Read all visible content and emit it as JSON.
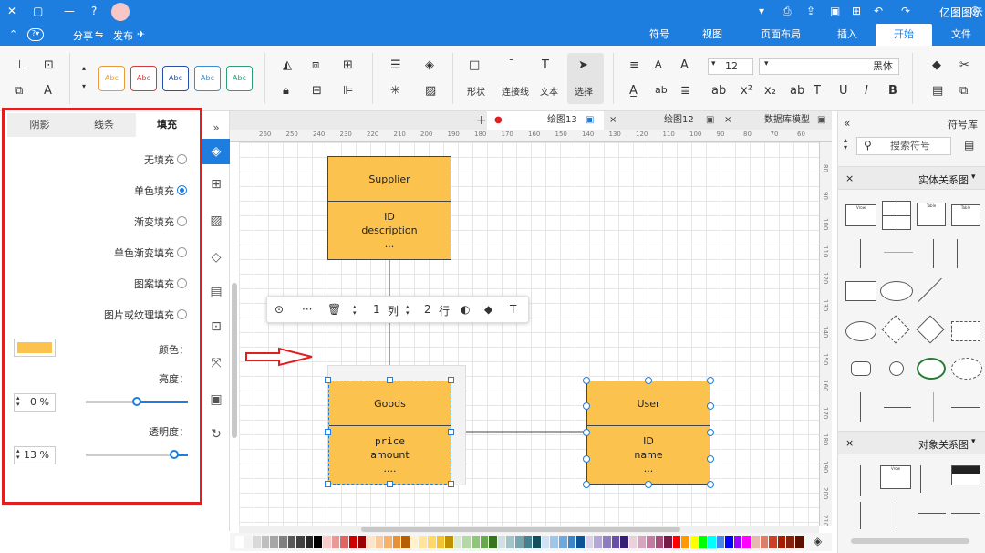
{
  "titlebar": {
    "app_name": "亿图图示",
    "file_label": "文件"
  },
  "menubar": {
    "tabs": [
      "开始",
      "插入",
      "页面布局",
      "视图",
      "符号"
    ],
    "active_tab": "开始",
    "file_label": "文件",
    "publish_label": "发布",
    "share_label": "分享"
  },
  "toolbar": {
    "font_name": "黑体",
    "font_size": "12",
    "select_label": "选择",
    "text_label": "文本",
    "connector_label": "连接线",
    "shape_label": "形状",
    "style_sample": "Abc"
  },
  "left_panel": {
    "tabs": [
      "填充",
      "线条",
      "阴影"
    ],
    "active_tab": "填充",
    "fill_options": [
      "无填充",
      "单色填充",
      "渐变填充",
      "单色渐变填充",
      "图案填充",
      "图片或纹理填充"
    ],
    "selected_option": "单色填充",
    "color_label": "颜色：",
    "brightness_label": "亮度：",
    "brightness_value": "0 %",
    "brightness_level": 0.5,
    "transparency_label": "透明度：",
    "transparency_value": "13 %",
    "transparency_level": 0.13,
    "fill_color": "#fcc24e"
  },
  "doc_tabs": [
    "数据库模型",
    "绘图12",
    "绘图13"
  ],
  "active_doc": "绘图13",
  "ruler_h": [
    "60",
    "70",
    "80",
    "90",
    "100",
    "110",
    "120",
    "130",
    "140",
    "150",
    "160",
    "170",
    "180",
    "190",
    "200",
    "210",
    "220",
    "230",
    "240",
    "250",
    "260"
  ],
  "ruler_v": [
    "80",
    "90",
    "100",
    "110",
    "120",
    "130",
    "140",
    "150",
    "160",
    "170",
    "180",
    "190",
    "200",
    "210",
    "220"
  ],
  "entities": {
    "supplier": {
      "title": "Supplier",
      "lines": [
        "ID",
        "description",
        "..."
      ]
    },
    "goods": {
      "title": "Goods",
      "lines": [
        "price",
        "amount",
        "...."
      ]
    },
    "user": {
      "title": "User",
      "lines": [
        "ID",
        "name",
        "..."
      ]
    }
  },
  "float_toolbar": {
    "row_label": "行",
    "row_value": "2",
    "col_label": "列",
    "col_value": "1"
  },
  "right_panel": {
    "title": "符号库",
    "search_placeholder": "搜索符号",
    "section1": "实体关系图",
    "section2": "对象关系图",
    "shape_labels": [
      "Table",
      "Table",
      "Vrow"
    ]
  }
}
